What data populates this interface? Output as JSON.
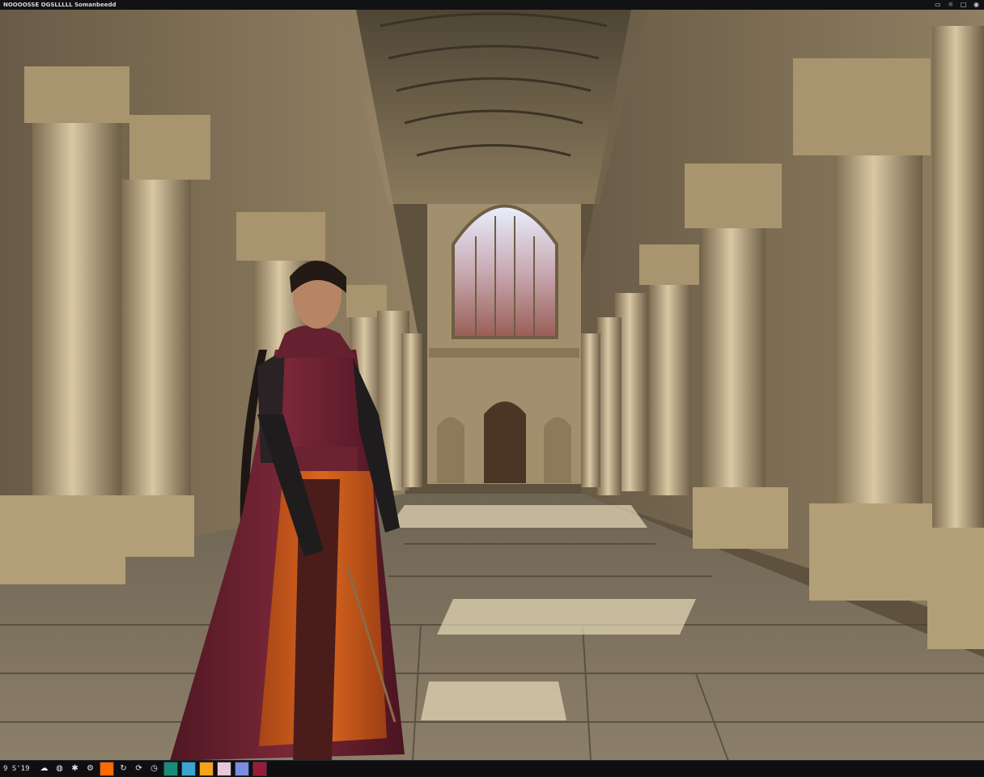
{
  "window": {
    "title": "NOOOOSSE OGSLLLLL Somanbeedd"
  },
  "taskbar": {
    "clock": "9 S'19",
    "icons": [
      "cloud-icon",
      "globe-icon",
      "settings-icon",
      "gear-icon",
      "sync-icon",
      "refresh-icon"
    ],
    "swatches": [
      "#ff6a00",
      "#1a8a7a",
      "#3aa6d0",
      "#f6a21a",
      "#e8c8d8",
      "#7a8de0",
      "#9a1a3a"
    ]
  },
  "scene": {
    "description_colors": {
      "stone_light": "#d8c8a2",
      "stone_mid": "#b6a17a",
      "stone_dark": "#5f513d",
      "robe_crimson": "#6b1f2e",
      "robe_orange": "#c4571c"
    }
  }
}
